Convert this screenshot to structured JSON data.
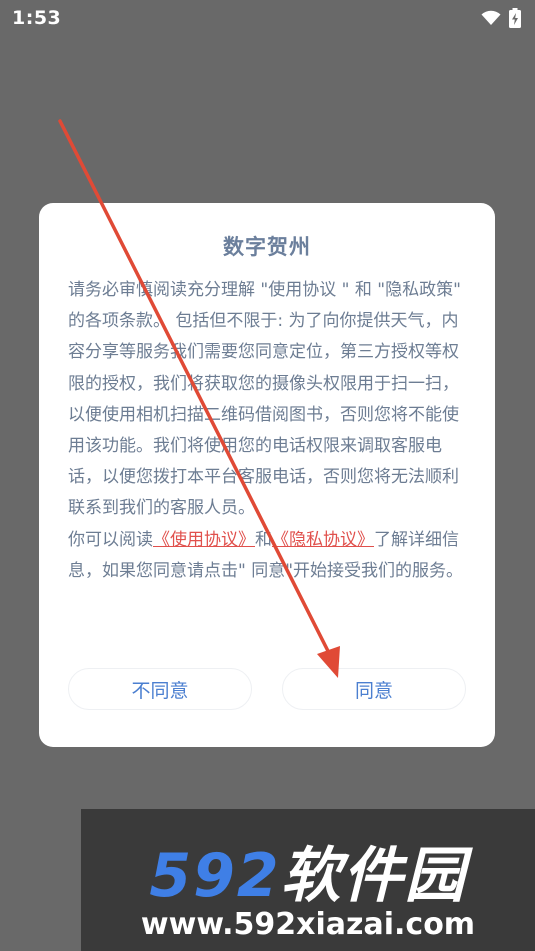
{
  "status_bar": {
    "time": "1:53"
  },
  "dialog": {
    "title": "数字贺州",
    "paragraph_1": "请务必审慎阅读充分理解 \"使用协议 \" 和 \"隐私政策\" 的各项条款。 包括但不限于: 为了向你提供天气，内容分享等服务我们需要您同意定位，第三方授权等权限的授权，我们将获取您的摄像头权限用于扫一扫，以便使用相机扫描二维码借阅图书，否则您将不能使用该功能。我们将使用您的电话权限来调取客服电话，以便您拨打本平台客服电话，否则您将无法顺利联系到我们的客服人员。",
    "paragraph_2": {
      "prefix": "你可以阅读",
      "link_terms": "《使用协议》",
      "conjunction": "和",
      "link_privacy": "《隐私协议》",
      "suffix": "了解详细信息，如果您同意请点击\" 同意\"开始接受我们的服务。"
    },
    "disagree_label": "不同意",
    "agree_label": "同意"
  },
  "watermark": {
    "brand_digits": "592",
    "brand_text": "软件园",
    "url": "www.592xiazai.com"
  },
  "colors": {
    "overlay": "#696969",
    "title": "#6b7f9c",
    "body_text": "#6d7d93",
    "link": "#e0504c",
    "button_text": "#4b7fd0",
    "annotation_arrow": "#e04a36",
    "watermark_blue": "#3f7fe6"
  }
}
